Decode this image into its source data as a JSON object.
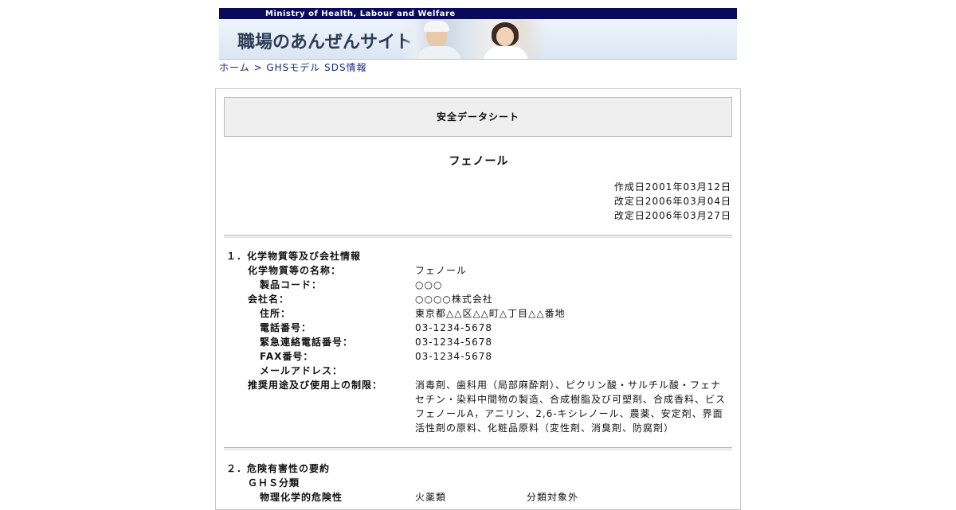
{
  "header": {
    "ministry": "Ministry of Health, Labour and Welfare",
    "site_title": "職場のあんぜんサイト"
  },
  "breadcrumb": {
    "home": "ホーム",
    "separator": ">",
    "current": "GHSモデル SDS情報"
  },
  "document": {
    "type": "安全データシート",
    "product_name": "フェノール",
    "dates": [
      "作成日2001年03月12日",
      "改定日2006年03月04日",
      "改定日2006年03月27日"
    ]
  },
  "section1": {
    "title": "１．化学物質等及び会社情報",
    "rows": [
      {
        "label": "化学物質等の名称：",
        "value": "フェノール"
      },
      {
        "label": "製品コード：",
        "value": "○○○"
      },
      {
        "label": "会社名：",
        "value": "○○○○株式会社"
      },
      {
        "label": "住所：",
        "value": "東京都△△区△△町△丁目△△番地"
      },
      {
        "label": "電話番号：",
        "value": "03-1234-5678"
      },
      {
        "label": "緊急連絡電話番号：",
        "value": "03-1234-5678"
      },
      {
        "label": "FAX番号：",
        "value": "03-1234-5678"
      },
      {
        "label": "メールアドレス：",
        "value": ""
      },
      {
        "label": "推奨用途及び使用上の制限：",
        "value_lines": [
          "消毒剤、歯科用（局部麻酔剤）、ピクリン酸・サルチル酸・フェナ",
          "セチン・染料中間物の製造、合成樹脂及び可塑剤、合成香料、ビス",
          "フェノールA，アニリン、2,6-キシレノール、農薬、安定剤、界面",
          "活性剤の原料、化粧品原料（変性剤、消臭剤、防腐剤）"
        ]
      }
    ]
  },
  "section2": {
    "title": "２．危険有害性の要約",
    "ghs_label": "ＧＨＳ分類",
    "physical_label": "物理化学的危険性",
    "hazard_class": "火薬類",
    "hazard_result": "分類対象外"
  },
  "colors": {
    "ministry_bar": "#0a0a5a",
    "link": "#1a2a7a",
    "box_bg": "#efefef"
  }
}
